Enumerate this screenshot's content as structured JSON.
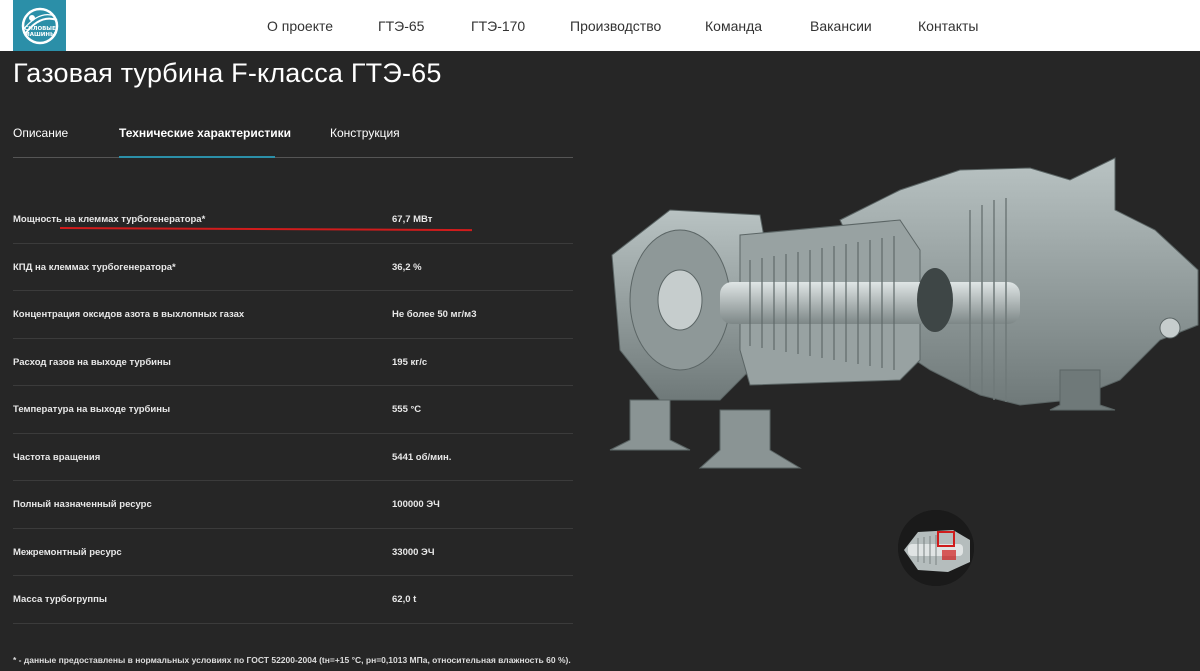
{
  "nav": {
    "logo_alt": "Силовые машины",
    "items": [
      "О проекте",
      "ГТЭ-65",
      "ГТЭ-170",
      "Производство",
      "Команда",
      "Вакансии",
      "Контакты"
    ]
  },
  "page": {
    "title": "Газовая турбина F-класса ГТЭ-65"
  },
  "tabs": {
    "description": "Описание",
    "specs": "Технические характеристики",
    "construction": "Конструкция"
  },
  "specs": [
    {
      "label": "Мощность на клеммах турбогенератора*",
      "value": "67,7 МВт"
    },
    {
      "label": "КПД на клеммах турбогенератора*",
      "value": "36,2 %"
    },
    {
      "label": "Концентрация оксидов азота в выхлопных газах",
      "value": "Не более 50 мг/м3"
    },
    {
      "label": "Расход газов на выходе турбины",
      "value": "195 кг/с"
    },
    {
      "label": "Температура на выходе турбины",
      "value": "555 °C"
    },
    {
      "label": "Частота вращения",
      "value": "5441 об/мин."
    },
    {
      "label": "Полный назначенный ресурс",
      "value": "100000 ЭЧ"
    },
    {
      "label": "Межремонтный ресурс",
      "value": "33000 ЭЧ"
    },
    {
      "label": "Масса турбогруппы",
      "value": "62,0 t"
    }
  ],
  "footnote": "* - данные предоставлены в нормальных условиях по ГОСТ 52200-2004 (tн=+15 °C, pн=0,1013 МПа, относительная влажность 60 %).",
  "colors": {
    "accent": "#2b8fa8",
    "highlight": "#d01c1c",
    "background": "#262626"
  }
}
